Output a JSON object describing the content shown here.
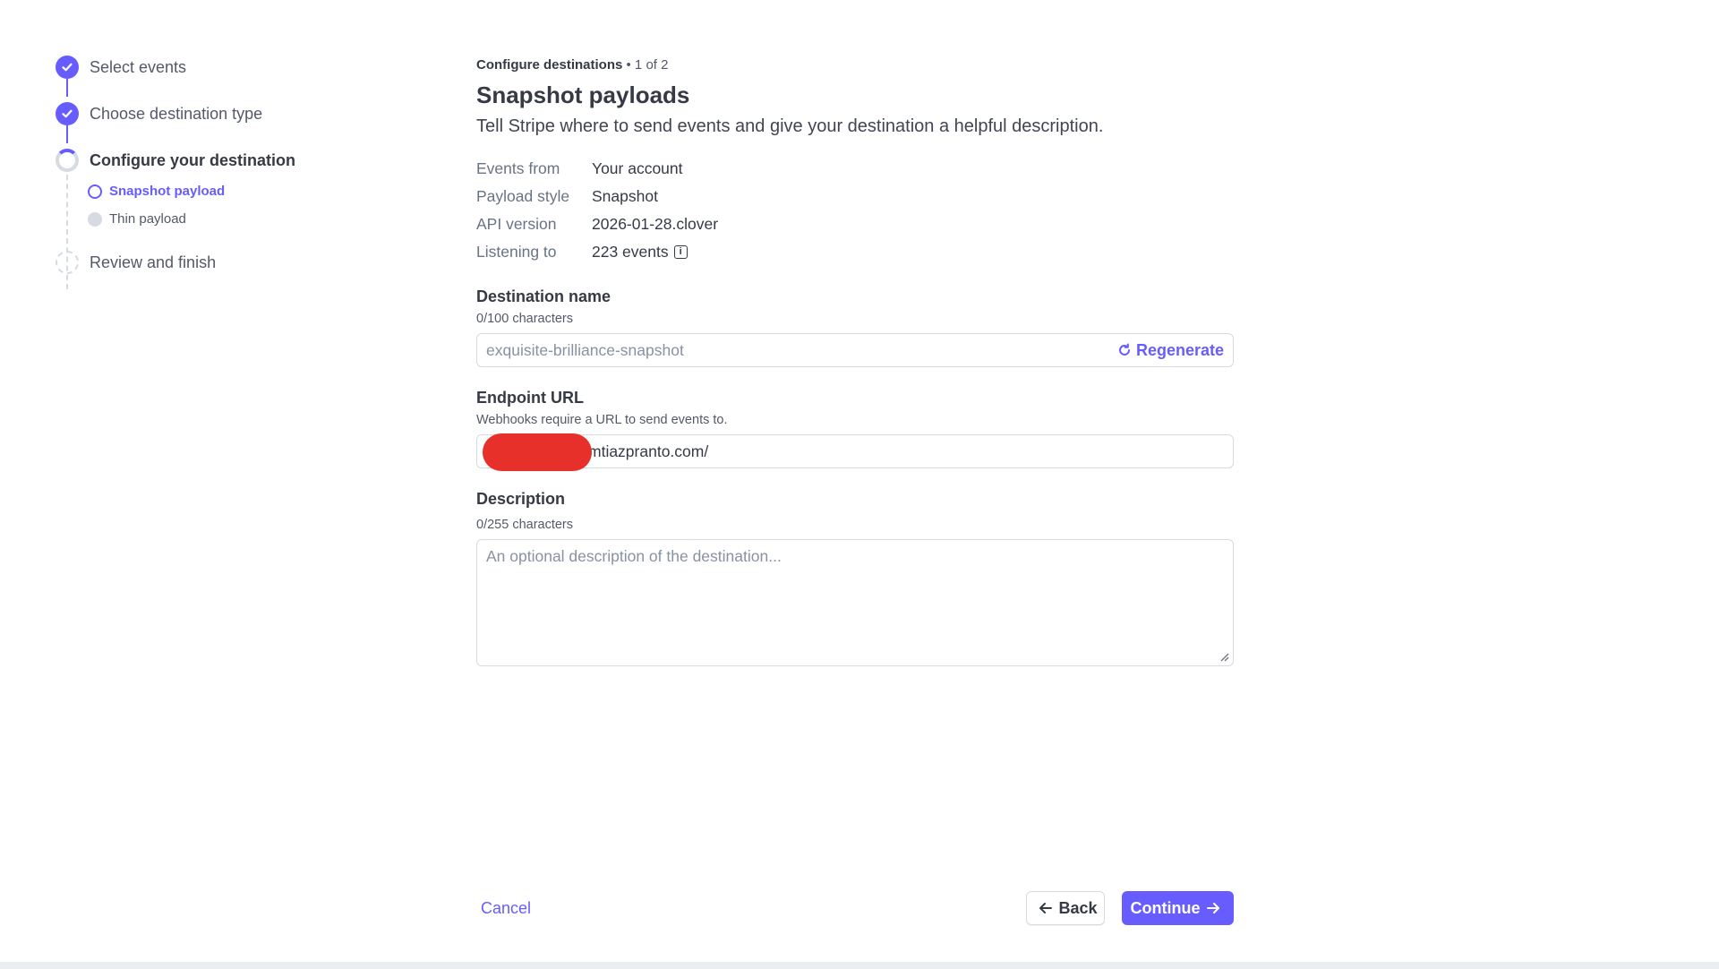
{
  "stepper": {
    "steps": [
      {
        "label": "Select events",
        "status": "done"
      },
      {
        "label": "Choose destination type",
        "status": "done"
      },
      {
        "label": "Configure your destination",
        "status": "current"
      },
      {
        "label": "Review and finish",
        "status": "pending"
      }
    ],
    "substeps": [
      {
        "label": "Snapshot payload",
        "status": "active"
      },
      {
        "label": "Thin payload",
        "status": "idle"
      }
    ]
  },
  "header": {
    "crumb_section": "Configure destinations",
    "crumb_progress": "• 1 of 2",
    "title": "Snapshot payloads",
    "subtitle": "Tell Stripe where to send events and give your destination a helpful description."
  },
  "summary": [
    {
      "key": "Events from",
      "value": "Your account"
    },
    {
      "key": "Payload style",
      "value": "Snapshot"
    },
    {
      "key": "API version",
      "value": "2026-01-28.clover"
    },
    {
      "key": "Listening to",
      "value": "223 events"
    }
  ],
  "form": {
    "destination_name": {
      "label": "Destination name",
      "help": "0/100 characters",
      "placeholder": "exquisite-brilliance-snapshot",
      "regenerate_label": "Regenerate"
    },
    "endpoint_url": {
      "label": "Endpoint URL",
      "help": "Webhooks require a URL to send events to.",
      "value": "mtiazpranto.com/"
    },
    "description": {
      "label": "Description",
      "help": "0/255 characters",
      "placeholder": "An optional description of the destination..."
    }
  },
  "footer": {
    "cancel_label": "Cancel",
    "back_label": "Back",
    "continue_label": "Continue"
  },
  "colors": {
    "accent": "#675dff",
    "redaction": "#e8302a",
    "border": "#d5dbe1"
  }
}
